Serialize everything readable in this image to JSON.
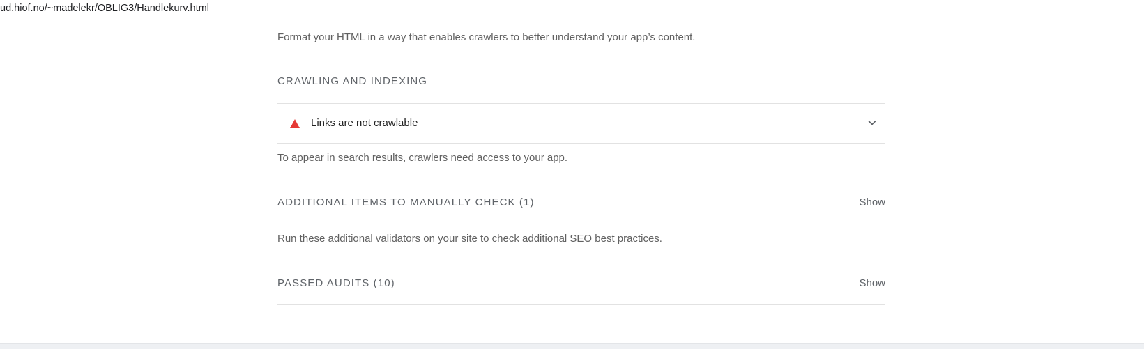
{
  "address_bar": {
    "url": "ud.hiof.no/~madelekr/OBLIG3/Handlekurv.html"
  },
  "seo": {
    "intro_description": "Format your HTML in a way that enables crawlers to better understand your app’s content.",
    "crawling_group": {
      "title": "CRAWLING AND INDEXING",
      "audits": [
        {
          "title": "Links are not crawlable",
          "status": "fail",
          "status_icon": "red-triangle-icon",
          "status_color": "#e53935",
          "expand_icon": "chevron-down-icon"
        }
      ],
      "description": "To appear in search results, crawlers need access to your app."
    },
    "manual_group": {
      "title": "ADDITIONAL ITEMS TO MANUALLY CHECK (1)",
      "toggle_label": "Show",
      "description": "Run these additional validators on your site to check additional SEO best practices."
    },
    "passed_group": {
      "title": "PASSED AUDITS (10)",
      "toggle_label": "Show"
    }
  }
}
